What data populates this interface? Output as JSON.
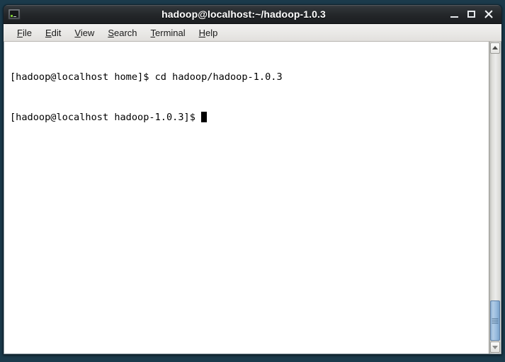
{
  "window": {
    "title": "hadoop@localhost:~/hadoop-1.0.3",
    "icon": "terminal-icon",
    "controls": {
      "minimize": "minimize-icon",
      "maximize": "maximize-icon",
      "close": "close-icon"
    }
  },
  "menubar": {
    "items": [
      {
        "label": "File",
        "mnemonic": "F",
        "rest": "ile"
      },
      {
        "label": "Edit",
        "mnemonic": "E",
        "rest": "dit"
      },
      {
        "label": "View",
        "mnemonic": "V",
        "rest": "iew"
      },
      {
        "label": "Search",
        "mnemonic": "S",
        "rest": "earch"
      },
      {
        "label": "Terminal",
        "mnemonic": "T",
        "rest": "erminal"
      },
      {
        "label": "Help",
        "mnemonic": "H",
        "rest": "elp"
      }
    ]
  },
  "terminal": {
    "lines": [
      "[hadoop@localhost home]$ cd hadoop/hadoop-1.0.3",
      "[hadoop@localhost hadoop-1.0.3]$ "
    ],
    "prompt_user": "hadoop",
    "prompt_host": "localhost",
    "current_directory": "hadoop-1.0.3",
    "last_command": "cd hadoop/hadoop-1.0.3",
    "cursor_visible": true,
    "background_color": "#ffffff",
    "text_color": "#000000"
  },
  "scrollbar": {
    "up_arrow": "scroll-up-icon",
    "down_arrow": "scroll-down-icon",
    "thumb_top_percent": 86,
    "thumb_height_percent": 14
  },
  "colors": {
    "desktop": "#1b3a4b",
    "titlebar": "#232629",
    "menubar": "#e9e8e6",
    "scrollbar_thumb": "#9cbee0"
  }
}
